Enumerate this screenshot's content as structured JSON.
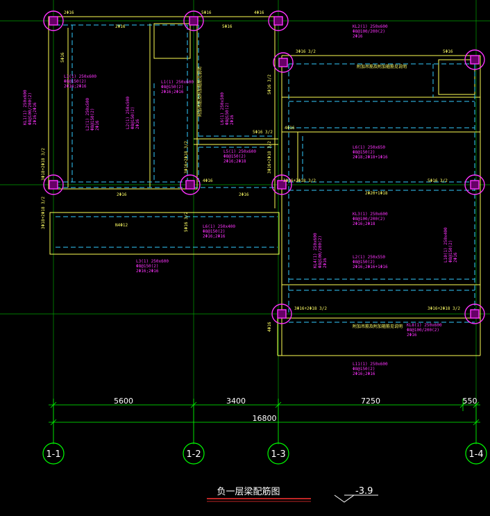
{
  "title": "负一层梁配筋图",
  "elevation": "-3.9",
  "axes": [
    "1-1",
    "1-2",
    "1-3",
    "1-4"
  ],
  "dimensions": {
    "spans": [
      "5600",
      "3400",
      "7250",
      "550"
    ],
    "total": "16800"
  },
  "colors": {
    "background": "#000000",
    "axis_bubble": "#00ff00",
    "dimension": "#00ff00",
    "beam_edge": "#ffff66",
    "beam_hidden": "#33ccff",
    "annotation": "#ff33ff",
    "column": "#ff33ff"
  },
  "beam_labels": {
    "tl": [
      "KL1(1) 250x600",
      "Φ8@100/200(2)",
      "2Φ16;2Φ16"
    ],
    "l1": [
      "L1(1) 250x600",
      "Φ8@150(2)",
      "2Φ16;2Φ16"
    ],
    "l1b": [
      "L1(1) 250x600",
      "Φ8@150(2)",
      "2Φ16;2Φ16"
    ],
    "l2a": [
      "L2(1) 250x500",
      "Φ8@150(2)",
      "2Φ16"
    ],
    "l2b": [
      "L2(1) 250x500",
      "Φ8@150(2)",
      "2Φ16"
    ],
    "l5": [
      "L5(1) 250x600",
      "Φ8@150(2)",
      "2Φ16;2Φ18"
    ],
    "l6": [
      "L6(1) 250x500",
      "Φ8@150(2)",
      "2Φ16"
    ],
    "l6r": [
      "L6(1) 250x650",
      "Φ8@150(2)",
      "2Φ18;2Φ18+1Φ16"
    ],
    "kl2": [
      "KL2(1) 250x600",
      "Φ8@100/200(2)",
      "2Φ16"
    ],
    "kl3": [
      "KL3(1) 250x600",
      "Φ8@100/200(2)",
      "2Φ16;2Φ18"
    ],
    "l3": [
      "L3(1) 250x600",
      "Φ8@150(2)",
      "2Φ16;2Φ16"
    ],
    "l6b": [
      "L6(1) 250x400",
      "Φ8@150(2)",
      "2Φ16;2Φ16"
    ],
    "kl4": [
      "KL4(1) 250x600",
      "Φ8@100/200(2)",
      "2Φ16"
    ],
    "l2r": [
      "L2(1) 250x550",
      "Φ8@150(2)",
      "2Φ16;2Φ16+1Φ16"
    ],
    "l10": [
      "L10(1) 250x400",
      "Φ8@150(2)",
      "2Φ16"
    ],
    "kl8": [
      "KL8(1) 250x600",
      "Φ8@100/200(2)",
      "2Φ16"
    ],
    "l11": [
      "L11(1) 250x600",
      "Φ8@150(2)",
      "2Φ16;2Φ16"
    ]
  },
  "yellow_labels": {
    "a": "2Φ16",
    "b": "5Φ16",
    "c": "4Φ16",
    "d": "3Φ16",
    "e": "2Φ16",
    "f": "3Φ16 3/2",
    "g": "5Φ16 3/2",
    "h": "3Φ16+2Φ18 3/2",
    "i": "2Φ20+1Φ18",
    "j": "4Φ16",
    "k": "3Φ18+2Φ18 3/2",
    "l": "5Φ16 3/2",
    "m": "2Φ16",
    "n": "N4Φ12",
    "o": "3Φ16+2Φ18 3/2",
    "p": "3Φ16+2Φ18 3/2",
    "q": "2Φ16",
    "r": "N2Φ12",
    "s": "4Φ16",
    "t": "3Φ18",
    "u": "5Φ16 3/2",
    "v": "4Φ16",
    "w": "附加吊筋及附加箍筋见说明",
    "x": "附加吊筋及附加箍筋见说明",
    "y": "附加吊筋及附加箍筋见说明"
  }
}
